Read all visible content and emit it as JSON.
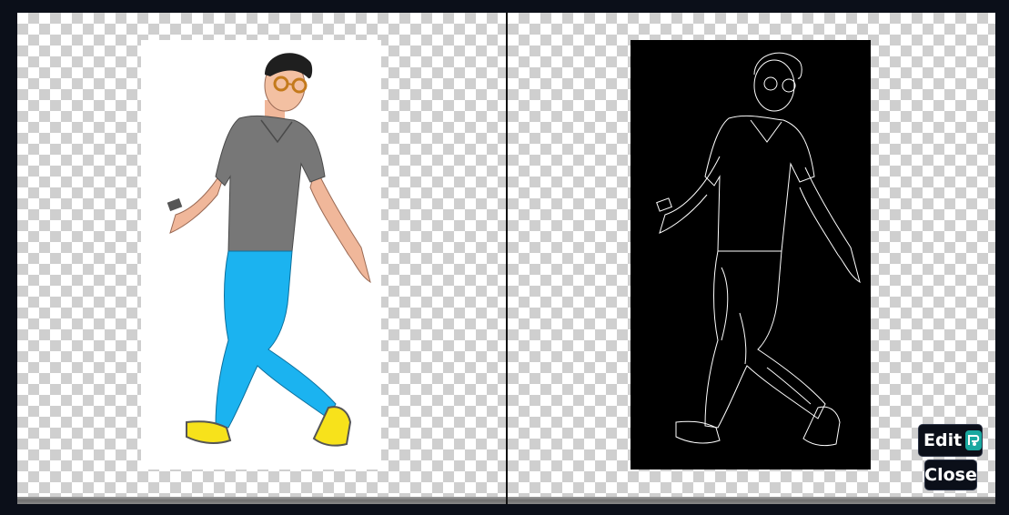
{
  "viewer": {
    "edit_label": "Edit",
    "close_label": "Close",
    "edit_icon": "edit-logo-icon"
  },
  "images": {
    "left": "original-illustration-walking-man",
    "right": "edge-detection-output-walking-man"
  }
}
